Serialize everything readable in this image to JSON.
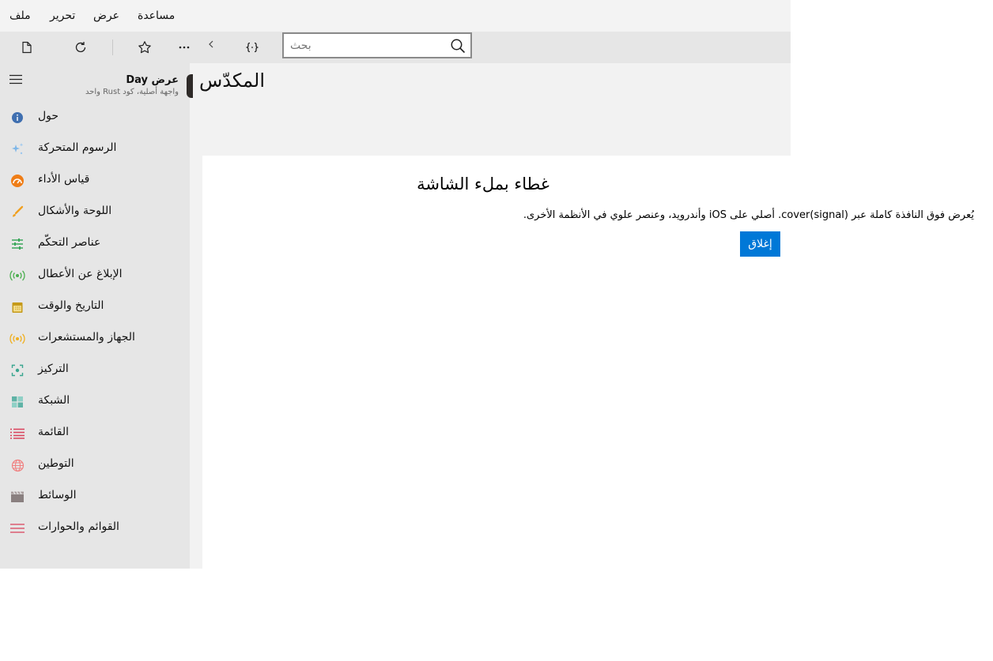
{
  "menu": [
    "ملف",
    "تحرير",
    "عرض",
    "مساعدة"
  ],
  "search": {
    "placeholder": "بحث"
  },
  "sidebar": {
    "title": "عرض Day",
    "subtitle": "واجهة أصلية، كود Rust واحد",
    "items": [
      {
        "label": "حول",
        "icon": "info-icon",
        "color": "#3f6fb0"
      },
      {
        "label": "الرسوم المتحركة",
        "icon": "sparkle-icon",
        "color": "#7fb7e8"
      },
      {
        "label": "قياس الأداء",
        "icon": "gauge-icon",
        "color": "#ef7d16"
      },
      {
        "label": "اللوحة والأشكال",
        "icon": "brush-icon",
        "color": "#f0a020"
      },
      {
        "label": "عناصر التحكّم",
        "icon": "sliders-icon",
        "color": "#3aa65a"
      },
      {
        "label": "الإبلاغ عن الأعطال",
        "icon": "broadcast-icon",
        "color": "#4caf50"
      },
      {
        "label": "التاريخ والوقت",
        "icon": "calendar-icon",
        "color": "#c59a1a"
      },
      {
        "label": "الجهاز والمستشعرات",
        "icon": "sensor-icon",
        "color": "#f0b020"
      },
      {
        "label": "التركيز",
        "icon": "focus-icon",
        "color": "#3aa690"
      },
      {
        "label": "الشبكة",
        "icon": "grid-icon",
        "color": "#5fb3a6"
      },
      {
        "label": "القائمة",
        "icon": "list-icon",
        "color": "#d9405a"
      },
      {
        "label": "التوطين",
        "icon": "globe-icon",
        "color": "#f08080"
      },
      {
        "label": "الوسائط",
        "icon": "clapper-icon",
        "color": "#8a8080"
      },
      {
        "label": "القوائم والحوارات",
        "icon": "menu-lines-icon",
        "color": "#d9405a"
      }
    ]
  },
  "page": {
    "title": "المكدّس"
  },
  "overlay": {
    "title": "غطاء بملء الشاشة",
    "description": "يُعرض فوق النافذة كاملة عبر cover(signal). أصلي على iOS وأندرويد، وعنصر علوي في الأنظمة الأخرى.",
    "close_label": "إغلاق"
  },
  "colors": {
    "accent": "#0078d7"
  }
}
